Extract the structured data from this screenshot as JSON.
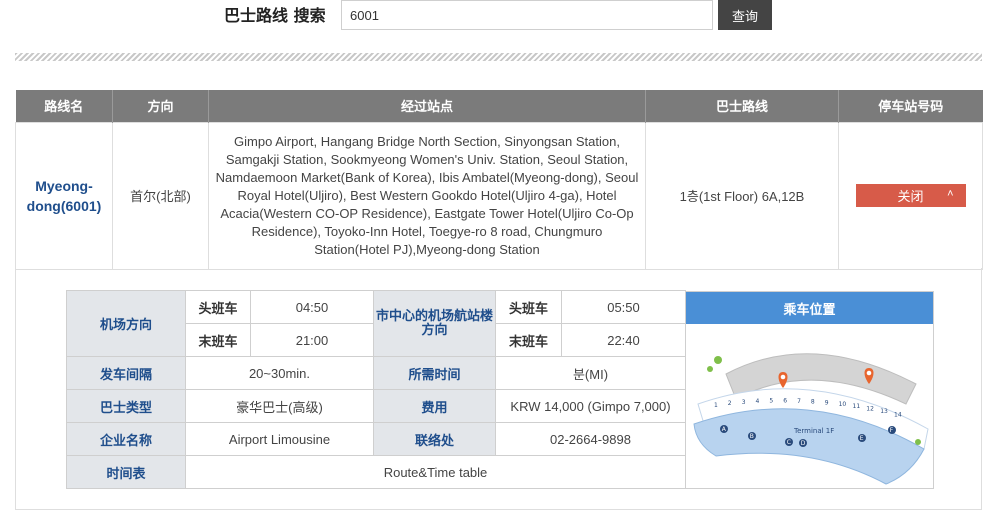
{
  "search": {
    "label": "巴士路线 搜索",
    "value": "6001",
    "button": "查询"
  },
  "table": {
    "headers": [
      "路线名",
      "方向",
      "经过站点",
      "巴士路线",
      "停车站号码"
    ],
    "row": {
      "route_name": "Myeong-dong(6001)",
      "direction": "首尔(北部)",
      "stops": "Gimpo Airport, Hangang Bridge North Section, Sinyongsan Station, Samgakji Station, Sookmyeong Women's Univ. Station, Seoul Station, Namdaemoon Market(Bank of Korea), Ibis Ambatel(Myeong-dong), Seoul Royal Hotel(Uljiro), Best Western Gookdo Hotel(Uljiro 4-ga), Hotel Acacia(Western CO-OP Residence), Eastgate Tower Hotel(Uljiro Co-Op Residence), Toyoko-Inn Hotel, Toegye-ro 8 road, Chungmuro Station(Hotel PJ),Myeong-dong Station",
      "bus_route": "1층(1st Floor) 6A,12B",
      "stop_button": "关闭"
    }
  },
  "detail": {
    "airport_dir": "机场方向",
    "city_dir": "市中心的机场航站楼方向",
    "first_bus": "头班车",
    "last_bus": "末班车",
    "airport_first": "04:50",
    "airport_last": "21:00",
    "city_first": "05:50",
    "city_last": "22:40",
    "interval_label": "发车间隔",
    "interval": "20~30min.",
    "duration_label": "所需时间",
    "duration": "분(MI)",
    "bus_type_label": "巴士类型",
    "bus_type": "豪华巴士(高级)",
    "fare_label": "费用",
    "fare": "KRW 14,000 (Gimpo 7,000)",
    "company_label": "企业名称",
    "company": "Airport Limousine",
    "contact_label": "联络处",
    "contact": "02-2664-9898",
    "timetable_label": "时间表",
    "timetable": "Route&Time table",
    "map_title": "乘车位置",
    "map": {
      "terminal_label": "Terminal 1F",
      "stop_numbers": [
        "1",
        "2",
        "3",
        "4",
        "5",
        "6",
        "7",
        "8",
        "9",
        "10",
        "11",
        "12",
        "13",
        "14"
      ],
      "gates": [
        "A",
        "B",
        "C",
        "D",
        "E",
        "F"
      ],
      "pin_color": "#e8652e"
    }
  },
  "colors": {
    "header_bg": "#7b7b7b",
    "route_link": "#1f4e8c",
    "close_button": "#d75b49",
    "map_header": "#4a8fd6"
  }
}
